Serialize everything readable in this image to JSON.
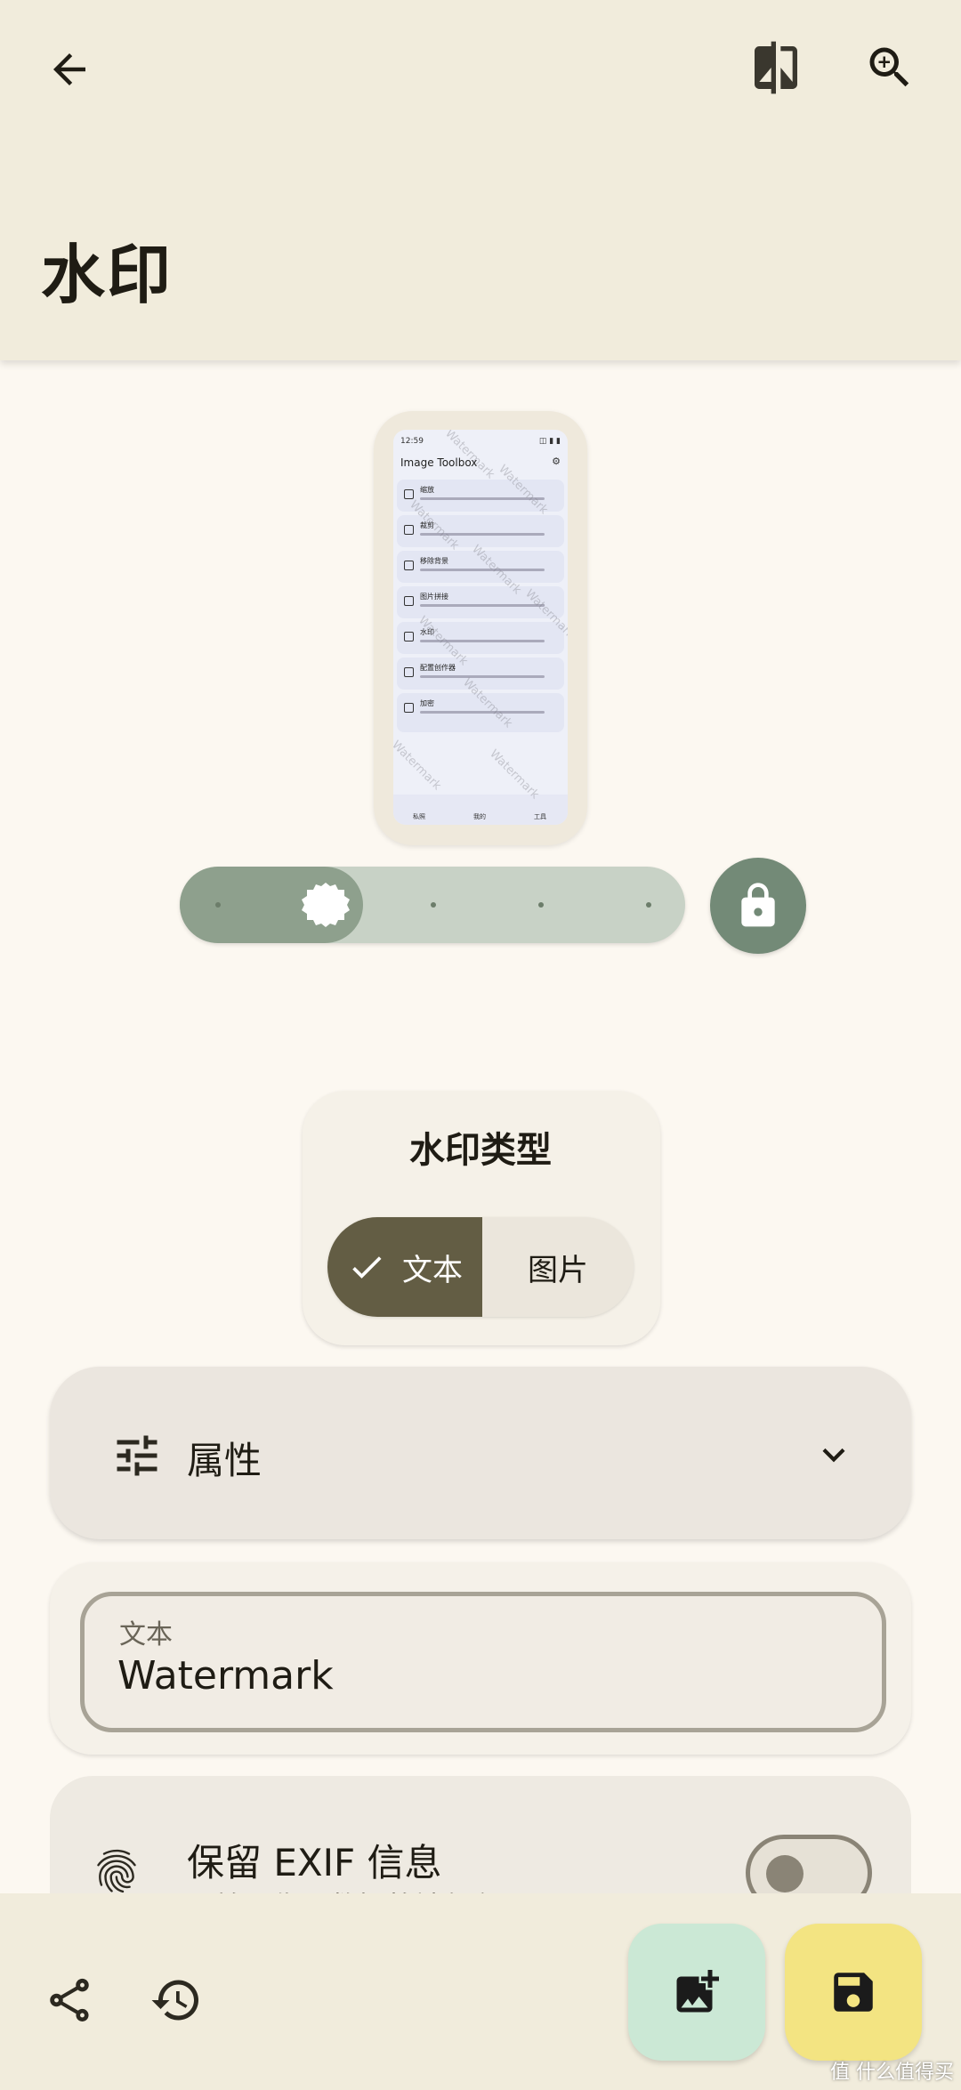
{
  "header": {
    "title": "水印"
  },
  "preview": {
    "status_time": "12:59",
    "status_right": "◫ ▮ ▮",
    "app_title": "Image Toolbox",
    "items": [
      {
        "title": "缩放"
      },
      {
        "title": "裁剪"
      },
      {
        "title": "移除背景"
      },
      {
        "title": "图片拼接"
      },
      {
        "title": "水印"
      },
      {
        "title": "配置创作器"
      },
      {
        "title": "加密"
      }
    ],
    "nav": [
      "私照",
      "我的",
      "工具"
    ],
    "watermark_text": "Watermark"
  },
  "slider": {
    "value_fraction": 0.25,
    "steps": 5
  },
  "watermark_type": {
    "title": "水印类型",
    "options": [
      "文本",
      "图片"
    ],
    "selected": "文本"
  },
  "properties": {
    "label": "属性"
  },
  "text_field": {
    "label": "文本",
    "value": "Watermark"
  },
  "exif": {
    "title": "保留 EXIF 信息",
    "subtitle": "原始图像元数据将被保留",
    "enabled": false
  },
  "credit": "值 什么值得买",
  "colors": {
    "accent": "#635d44",
    "fab_add": "#cbe8d5",
    "fab_save": "#f3e482",
    "lock": "#738a77"
  }
}
